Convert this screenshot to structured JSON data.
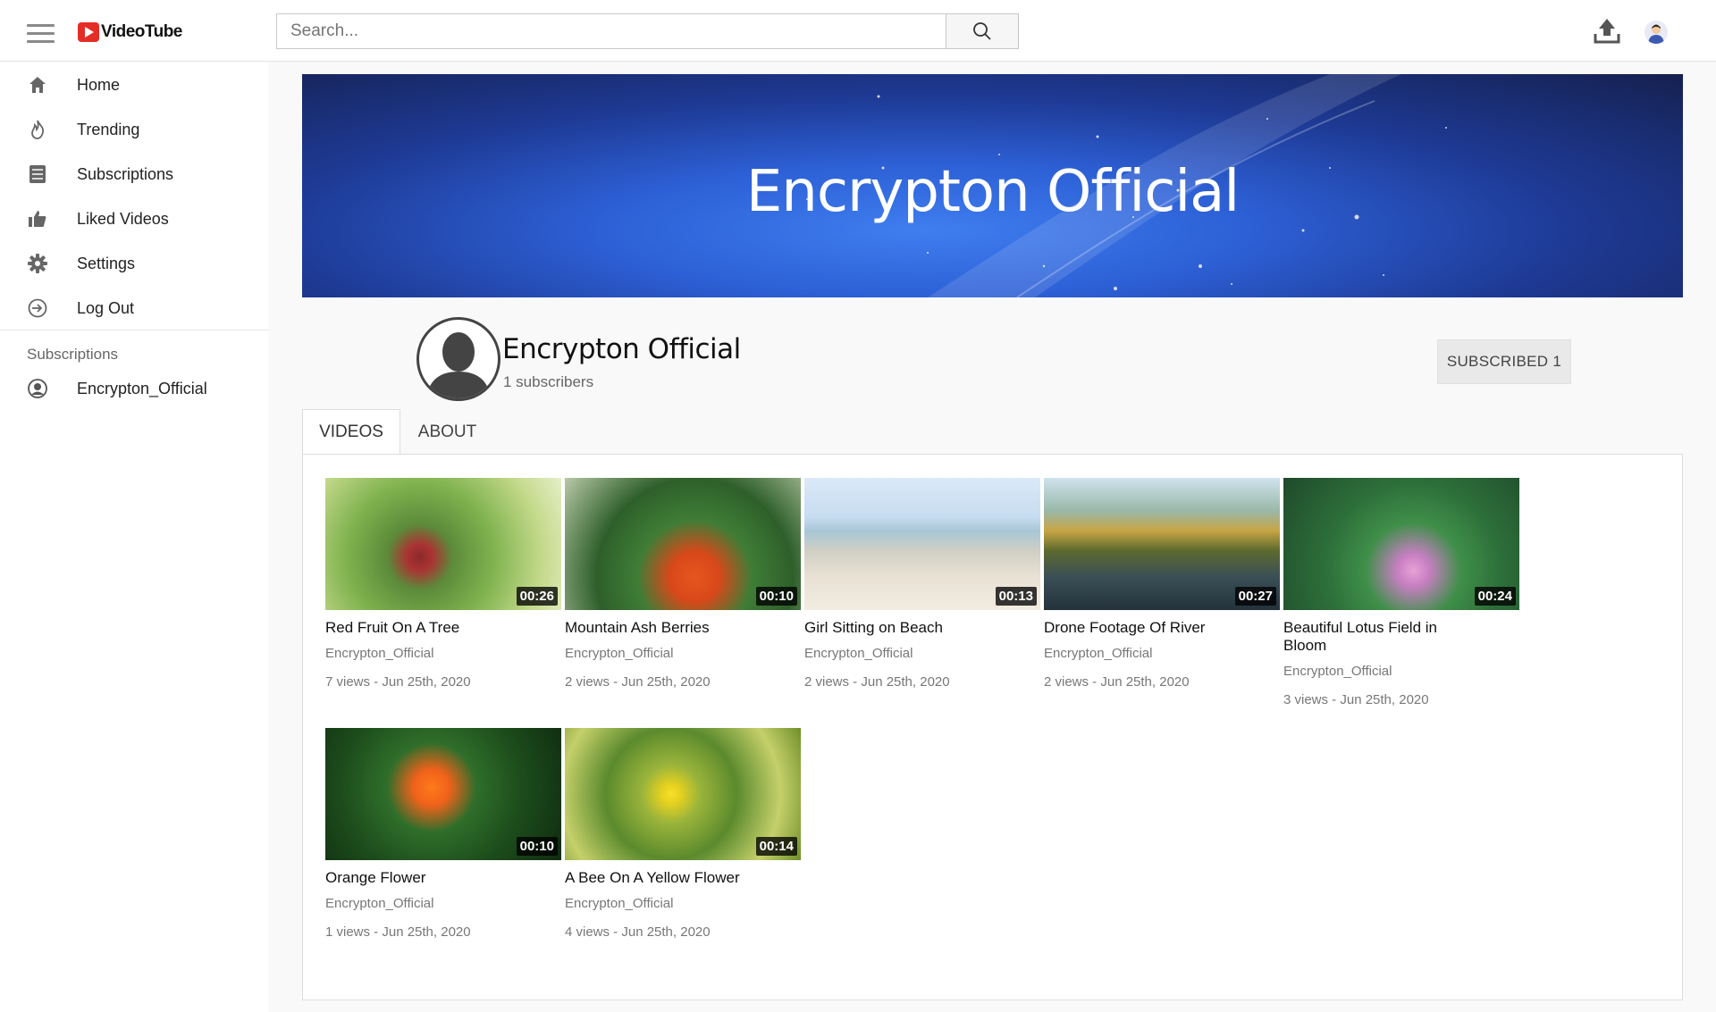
{
  "header": {
    "logo_text": "VideoTube",
    "search_placeholder": "Search..."
  },
  "sidebar": {
    "items": [
      {
        "label": "Home",
        "icon": "home-icon"
      },
      {
        "label": "Trending",
        "icon": "fire-icon"
      },
      {
        "label": "Subscriptions",
        "icon": "subscriptions-icon"
      },
      {
        "label": "Liked Videos",
        "icon": "thumbs-up-icon"
      },
      {
        "label": "Settings",
        "icon": "gear-icon"
      },
      {
        "label": "Log Out",
        "icon": "logout-icon"
      }
    ],
    "subscriptions_heading": "Subscriptions",
    "subscriptions": [
      {
        "label": "Encrypton_Official",
        "icon": "user-circle-icon"
      }
    ]
  },
  "channel": {
    "banner_title": "Encrypton Official",
    "name": "Encrypton Official",
    "subscribers": "1 subscribers",
    "subscribe_button": "SUBSCRIBED 1"
  },
  "tabs": [
    {
      "label": "VIDEOS",
      "active": true
    },
    {
      "label": "ABOUT",
      "active": false
    }
  ],
  "videos": [
    {
      "title": "Red Fruit On A Tree",
      "duration": "00:26",
      "channel": "Encrypton_Official",
      "meta": "7 views - Jun 25th, 2020",
      "thumb_bg": "radial-gradient(circle at 40% 60%, #8b2a2a 0%, #a33 8%, #5c8a3a 20%, #7fb24e 45%, #c3d98a 75%, #e6efc8 100%)"
    },
    {
      "title": "Mountain Ash Berries",
      "duration": "00:10",
      "channel": "Encrypton_Official",
      "meta": "2 views - Jun 25th, 2020",
      "thumb_bg": "radial-gradient(circle at 55% 75%, #e6561f 0%, #d9481a 15%, #3f7d36 35%, #2e5f2a 60%, #b9c9a8 100%)"
    },
    {
      "title": "Girl Sitting on Beach",
      "duration": "00:13",
      "channel": "Encrypton_Official",
      "meta": "2 views - Jun 25th, 2020",
      "thumb_bg": "linear-gradient(180deg, #dbe9f7 0%, #c6dcf0 30%, #a8c6d6 40%, #cfcfc4 55%, #e9e1d4 75%, #f2ece1 100%)"
    },
    {
      "title": "Drone Footage Of River",
      "duration": "00:27",
      "channel": "Encrypton_Official",
      "meta": "2 views - Jun 25th, 2020",
      "thumb_bg": "linear-gradient(180deg, #cfe3ee 0%, #9ab8a8 25%, #c7a544 40%, #5d6a2e 55%, #3a4f57 75%, #24323a 100%)"
    },
    {
      "title": "Beautiful Lotus Field in Bloom",
      "duration": "00:24",
      "channel": "Encrypton_Official",
      "meta": "3 views - Jun 25th, 2020",
      "thumb_bg": "radial-gradient(circle at 55% 70%, #e8a2d6 0%, #c77fc2 10%, #3f8f49 30%, #2d6f3a 55%, #1f4a2a 100%)"
    },
    {
      "title": "Orange Flower",
      "duration": "00:10",
      "channel": "Encrypton_Official",
      "meta": "1 views - Jun 25th, 2020",
      "thumb_bg": "radial-gradient(circle at 45% 45%, #ff7a1a 0%, #f0621b 12%, #2f6e2a 30%, #1d4d1c 60%, #0f2b10 100%)"
    },
    {
      "title": "A Bee On A Yellow Flower",
      "duration": "00:14",
      "channel": "Encrypton_Official",
      "meta": "4 views - Jun 25th, 2020",
      "thumb_bg": "radial-gradient(circle at 45% 50%, #f5e02a 0%, #e8d21f 6%, #9ab43b 20%, #5b8a2d 45%, #c5d06a 75%, #6f8f2a 100%)"
    }
  ]
}
